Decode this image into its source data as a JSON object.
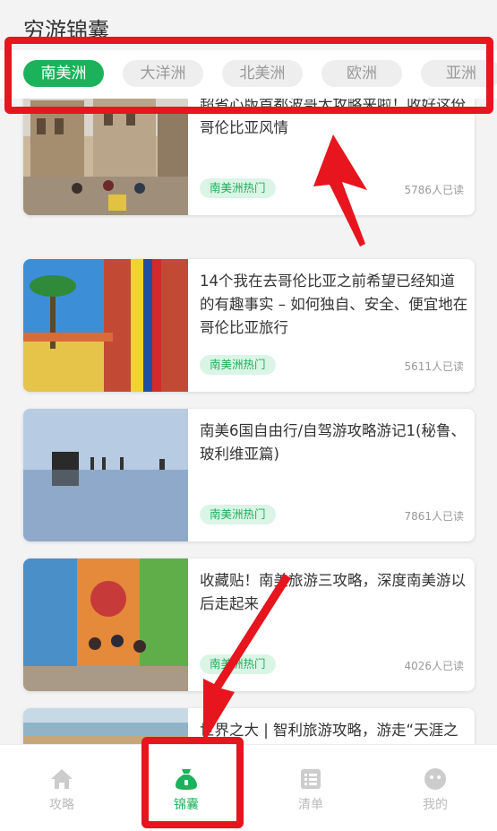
{
  "header": {
    "title": "穷游锦囊"
  },
  "tabs": [
    {
      "label": "南美洲",
      "active": true
    },
    {
      "label": "大洋洲",
      "active": false
    },
    {
      "label": "北美洲",
      "active": false
    },
    {
      "label": "欧洲",
      "active": false
    },
    {
      "label": "亚洲",
      "active": false
    }
  ],
  "cards": [
    {
      "title": "超省心版首都波哥大攻略来啦！收好这份哥伦比亚风情",
      "tag": "南美洲热门",
      "reads": "5786人已读"
    },
    {
      "title": "14个我在去哥伦比亚之前希望已经知道的有趣事实 – 如何独自、安全、便宜地在哥伦比亚旅行",
      "tag": "南美洲热门",
      "reads": "5611人已读"
    },
    {
      "title": "南美6国自由行/自驾游攻略游记1(秘鲁、玻利维亚篇)",
      "tag": "南美洲热门",
      "reads": "7861人已读"
    },
    {
      "title": "收藏贴！南美旅游三攻略，深度南美游以后走起来",
      "tag": "南美洲热门",
      "reads": "4026人已读"
    },
    {
      "title": "世界之大 | 智利旅游攻略，游走“天涯之",
      "tag": "",
      "reads": ""
    }
  ],
  "nav": [
    {
      "label": "攻略",
      "icon": "home-icon",
      "active": false
    },
    {
      "label": "锦囊",
      "icon": "bag-icon",
      "active": true
    },
    {
      "label": "清单",
      "icon": "list-icon",
      "active": false
    },
    {
      "label": "我的",
      "icon": "profile-icon",
      "active": false
    }
  ],
  "colors": {
    "accent": "#1cb25b",
    "annotation": "#e6151e",
    "tag_bg": "#daf5e6"
  }
}
